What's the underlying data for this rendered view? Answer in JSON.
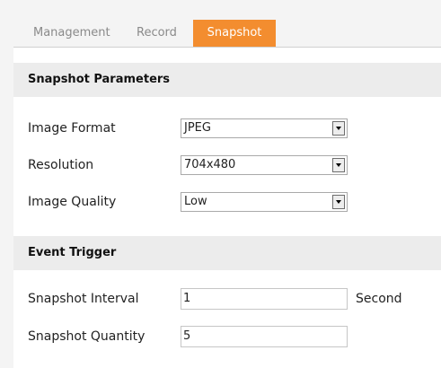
{
  "tabs": [
    {
      "label": "Management",
      "active": false
    },
    {
      "label": "Record",
      "active": false
    },
    {
      "label": "Snapshot",
      "active": true
    }
  ],
  "accent_color": "#f38d2f",
  "snapshot_parameters": {
    "title": "Snapshot Parameters",
    "image_format": {
      "label": "Image Format",
      "value": "JPEG"
    },
    "resolution": {
      "label": "Resolution",
      "value": "704x480"
    },
    "image_quality": {
      "label": "Image Quality",
      "value": "Low"
    }
  },
  "event_trigger": {
    "title": "Event Trigger",
    "snapshot_interval": {
      "label": "Snapshot Interval",
      "value": "1",
      "unit": "Second"
    },
    "snapshot_quantity": {
      "label": "Snapshot Quantity",
      "value": "5"
    }
  }
}
